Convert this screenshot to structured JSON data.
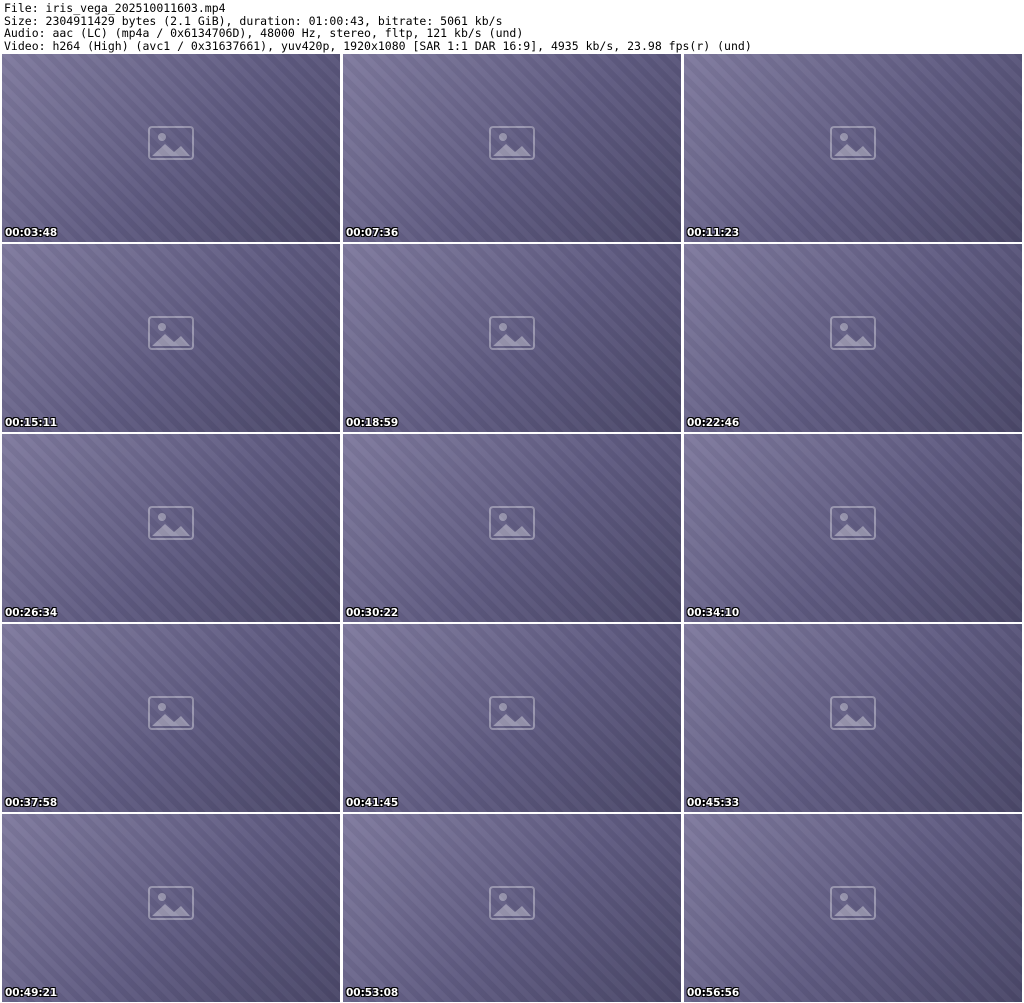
{
  "header": {
    "file": "File: iris_vega_202510011603.mp4",
    "size": "Size: 2304911429 bytes (2.1 GiB), duration: 01:00:43, bitrate: 5061 kb/s",
    "audio": "Audio: aac (LC) (mp4a / 0x6134706D), 48000 Hz, stereo, fltp, 121 kb/s (und)",
    "video": "Video: h264 (High) (avc1 / 0x31637661), yuv420p, 1920x1080 [SAR 1:1 DAR 16:9], 4935 kb/s, 23.98 fps(r) (und)"
  },
  "frames": [
    {
      "timestamp": "00:03:48"
    },
    {
      "timestamp": "00:07:36"
    },
    {
      "timestamp": "00:11:23"
    },
    {
      "timestamp": "00:15:11"
    },
    {
      "timestamp": "00:18:59"
    },
    {
      "timestamp": "00:22:46"
    },
    {
      "timestamp": "00:26:34"
    },
    {
      "timestamp": "00:30:22"
    },
    {
      "timestamp": "00:34:10"
    },
    {
      "timestamp": "00:37:58"
    },
    {
      "timestamp": "00:41:45"
    },
    {
      "timestamp": "00:45:33"
    },
    {
      "timestamp": "00:49:21"
    },
    {
      "timestamp": "00:53:08"
    },
    {
      "timestamp": "00:56:56"
    }
  ]
}
